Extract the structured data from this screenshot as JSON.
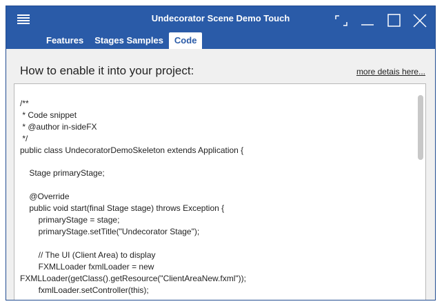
{
  "window": {
    "title": "Undecorator Scene Demo Touch",
    "accent_color": "#2a5ba8"
  },
  "titlebar": {
    "menu_icon": "hamburger-icon",
    "controls": [
      "fullscreen-icon",
      "minimize-icon",
      "maximize-icon",
      "close-icon"
    ]
  },
  "tabs": [
    {
      "label": "Features",
      "active": false
    },
    {
      "label": "Stages Samples",
      "active": false
    },
    {
      "label": "Code",
      "active": true
    }
  ],
  "content": {
    "heading": "How to enable it into your project:",
    "more_link": "more detais here...",
    "code": "/**\n * Code snippet\n * @author in-sideFX\n */\npublic class UndecoratorDemoSkeleton extends Application {\n\n    Stage primaryStage;\n\n    @Override\n    public void start(final Stage stage) throws Exception {\n        primaryStage = stage;\n        primaryStage.setTitle(\"Undecorator Stage\");\n\n        // The UI (Client Area) to display\n        FXMLLoader fxmlLoader = new\nFXMLLoader(getClass().getResource(\"ClientAreaNew.fxml\"));\n        fxmlLoader.setController(this);"
  }
}
